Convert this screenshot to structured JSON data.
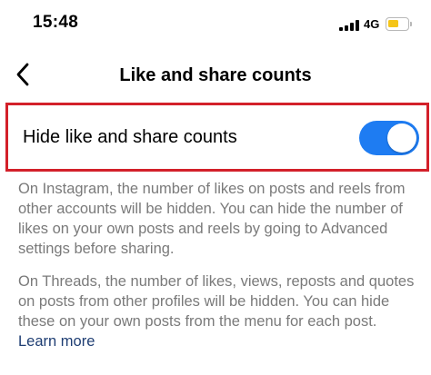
{
  "status_bar": {
    "time": "15:48",
    "network": "4G",
    "battery_color": "#f5c518"
  },
  "nav": {
    "back_icon": "chevron-left-icon",
    "title": "Like and share counts"
  },
  "setting": {
    "label": "Hide like and share counts",
    "toggle_on": true,
    "toggle_color": "#1e7cf2",
    "highlight_color": "#d3202a"
  },
  "descriptions": {
    "instagram": "On Instagram, the number of likes on posts and reels from other accounts will be hidden. You can hide the number of likes on your own posts and reels by going to Advanced settings before sharing.",
    "threads": "On Threads, the number of likes, views, reposts and quotes on posts from other profiles will be hidden. You can hide these on your own posts from the menu for each post.",
    "learn_more": "Learn more"
  }
}
